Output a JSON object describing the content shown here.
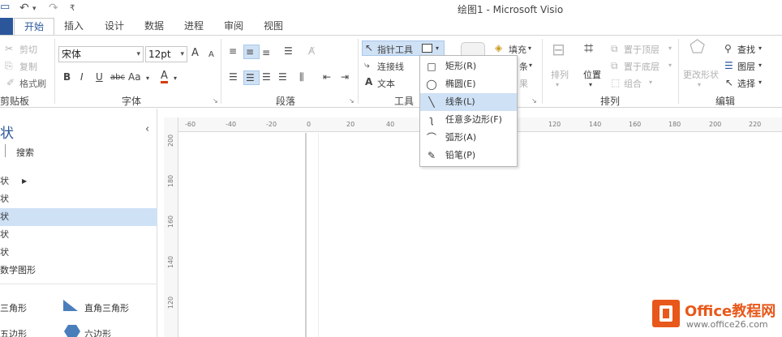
{
  "window": {
    "title": "绘图1 - Microsoft Visio",
    "qat": {
      "undo": "↶",
      "undo_arrow": "▾",
      "redo": "↷",
      "customize": "₹"
    }
  },
  "tabs": [
    "开始",
    "插入",
    "设计",
    "数据",
    "进程",
    "审阅",
    "视图"
  ],
  "ribbon": {
    "clipboard": {
      "label": "剪贴板",
      "cut": "剪切",
      "copy": "复制",
      "format_painter": "格式刷"
    },
    "font": {
      "label": "字体",
      "font_name": "宋体",
      "font_size": "12pt",
      "grow": "A",
      "shrink": "A",
      "bold": "B",
      "italic": "I",
      "underline": "U",
      "strike": "abc",
      "case": "Aa",
      "font_color": "A"
    },
    "paragraph": {
      "label": "段落"
    },
    "tools": {
      "label": "工具",
      "pointer": "指针工具",
      "connector": "连接线",
      "text": "文本"
    },
    "shape_styles": {
      "fill": "填充",
      "line": "条",
      "effects": "果"
    },
    "arrange": {
      "label": "排列",
      "arrange_btn": "排列",
      "position": "位置",
      "bring_to_front": "置于顶层",
      "send_to_back": "置于底层",
      "group": "组合"
    },
    "edit": {
      "label": "编辑",
      "change_shape": "更改形状",
      "find": "查找",
      "layers": "图层",
      "select": "选择"
    }
  },
  "tool_menu": {
    "items": [
      {
        "icon": "□",
        "label": "矩形(R)",
        "selected": false
      },
      {
        "icon": "◯",
        "label": "椭圆(E)",
        "selected": false
      },
      {
        "icon": "╲",
        "label": "线条(L)",
        "selected": true
      },
      {
        "icon": "ʅ",
        "label": "任意多边形(F)",
        "selected": false
      },
      {
        "icon": "⌒",
        "label": "弧形(A)",
        "selected": false
      },
      {
        "icon": "✎",
        "label": "铅笔(P)",
        "selected": false
      }
    ]
  },
  "shapes_panel": {
    "title": "状",
    "collapse": "‹",
    "search": "搜索",
    "items": [
      {
        "label": "状",
        "selected": false,
        "expand": "▶"
      },
      {
        "label": "状",
        "selected": false,
        "expand": ""
      },
      {
        "label": "状",
        "selected": true,
        "expand": ""
      },
      {
        "label": "状",
        "selected": false,
        "expand": ""
      },
      {
        "label": "状",
        "selected": false,
        "expand": ""
      },
      {
        "label": "数学图形",
        "selected": false,
        "expand": ""
      }
    ],
    "shapes": [
      {
        "label": "三角形"
      },
      {
        "label": "直角三角形"
      },
      {
        "label": "五边形"
      },
      {
        "label": "六边形"
      }
    ]
  },
  "ruler": {
    "h": [
      "-60",
      "-40",
      "-20",
      "0",
      "20",
      "40",
      "120",
      "140",
      "160",
      "180",
      "200",
      "220"
    ],
    "v": [
      "200",
      "180",
      "160",
      "140",
      "120"
    ]
  },
  "watermark": {
    "brand": "Office教程网",
    "url": "www.office26.com"
  },
  "colors": {
    "accent": "#2b579a",
    "selection": "#cfe1f5",
    "font_red": "#d83b01",
    "brand_orange": "#e8581a"
  }
}
